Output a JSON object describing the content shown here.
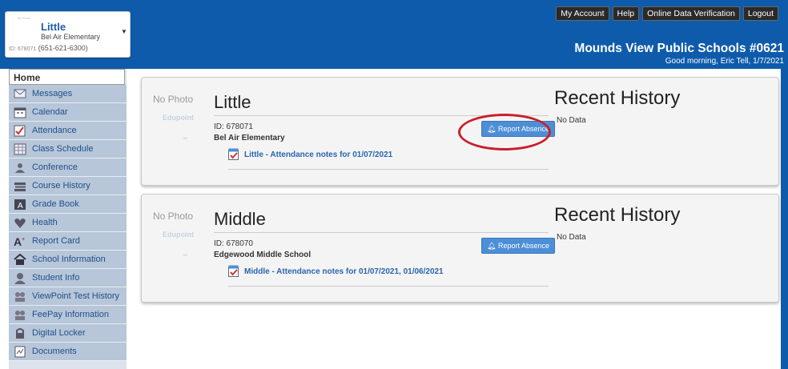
{
  "student_selector": {
    "photo_text": "No Photo",
    "name": "Little",
    "school": "Bel Air Elementary",
    "id_label": "ID: 678071",
    "phone": "(651-621-6300)"
  },
  "top_links": [
    "My Account",
    "Help",
    "Online Data Verification",
    "Logout"
  ],
  "district": "Mounds View Public Schools #0621",
  "greeting": "Good morning, Eric Tell, 1/7/2021",
  "sidebar": {
    "home": "Home",
    "items": [
      {
        "label": "Messages",
        "icon": "envelope-icon"
      },
      {
        "label": "Calendar",
        "icon": "calendar-icon"
      },
      {
        "label": "Attendance",
        "icon": "checkbox-icon"
      },
      {
        "label": "Class Schedule",
        "icon": "schedule-icon"
      },
      {
        "label": "Conference",
        "icon": "people-icon"
      },
      {
        "label": "Course History",
        "icon": "books-icon"
      },
      {
        "label": "Grade Book",
        "icon": "gradebook-icon"
      },
      {
        "label": "Health",
        "icon": "heart-icon"
      },
      {
        "label": "Report Card",
        "icon": "report-card-icon"
      },
      {
        "label": "School Information",
        "icon": "school-icon"
      },
      {
        "label": "Student Info",
        "icon": "person-icon"
      },
      {
        "label": "ViewPoint Test History",
        "icon": "group-icon"
      },
      {
        "label": "FeePay Information",
        "icon": "group-icon"
      },
      {
        "label": "Digital Locker",
        "icon": "lock-icon"
      },
      {
        "label": "Documents",
        "icon": "document-icon"
      }
    ]
  },
  "students": [
    {
      "photo_text": "No Photo",
      "logo_text": "Edupoint",
      "dash": "–",
      "name": "Little",
      "id": "ID: 678071",
      "school": "Bel Air Elementary",
      "report_button": "Report Absence",
      "notes_link": "Little - Attendance notes for 01/07/2021",
      "recent_history_title": "Recent History",
      "recent_history": "No Data"
    },
    {
      "photo_text": "No Photo",
      "logo_text": "Edupoint",
      "dash": "–",
      "name": "Middle",
      "id": "ID: 678070",
      "school": "Edgewood Middle School",
      "report_button": "Report Absence",
      "notes_link": "Middle - Attendance notes for 01/07/2021, 01/06/2021",
      "recent_history_title": "Recent History",
      "recent_history": "No Data"
    }
  ],
  "colors": {
    "header": "#0e5bab",
    "nav_item": "#b7c6d8",
    "button": "#4d8fd6",
    "highlight": "#c8202a"
  }
}
